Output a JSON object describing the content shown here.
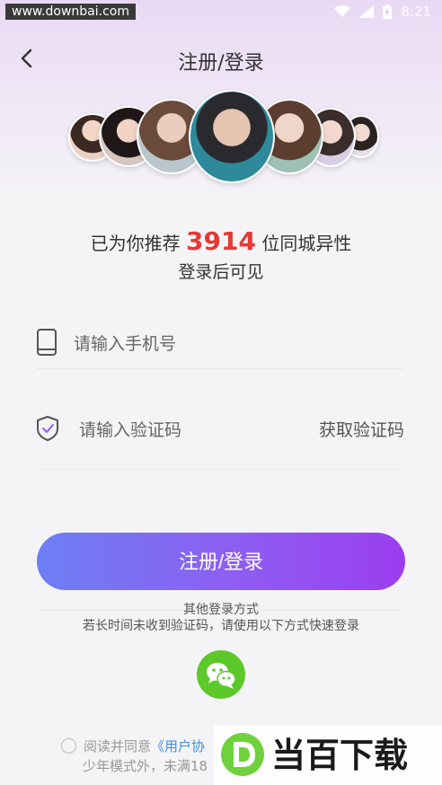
{
  "status_bar": {
    "watermark": "www.downbai.com",
    "time": "8:21"
  },
  "header": {
    "title": "注册/登录"
  },
  "promo": {
    "prefix": "已为你推荐",
    "count": "3914",
    "suffix": "位同城异性",
    "line2": "登录后可见"
  },
  "form": {
    "phone_placeholder": "请输入手机号",
    "code_placeholder": "请输入验证码",
    "get_code_label": "获取验证码",
    "submit_label": "注册/登录"
  },
  "alternatives": {
    "title": "其他登录方式",
    "hint": "若长时间未收到验证码，请使用以下方式快速登录"
  },
  "agreement": {
    "text": "阅读并同意",
    "link": "《用户协",
    "line2": "少年模式外，未满18"
  },
  "brand_watermark": {
    "text": "当百下载"
  },
  "colors": {
    "accent_start": "#6d7ff4",
    "accent_end": "#9b3df0",
    "highlight": "#e53935",
    "wechat": "#5cc829"
  }
}
